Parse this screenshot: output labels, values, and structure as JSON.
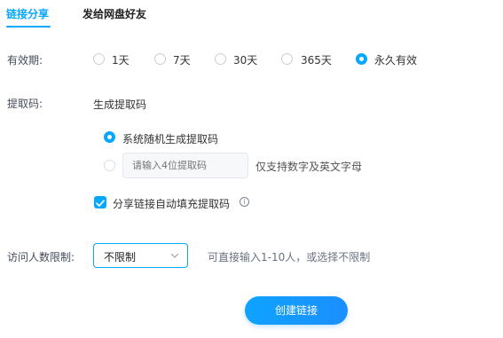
{
  "tabs": [
    {
      "label": "链接分享",
      "active": true
    },
    {
      "label": "发给网盘好友",
      "active": false
    }
  ],
  "validity": {
    "label": "有效期:",
    "options": [
      {
        "label": "1天",
        "selected": false
      },
      {
        "label": "7天",
        "selected": false
      },
      {
        "label": "30天",
        "selected": false
      },
      {
        "label": "365天",
        "selected": false
      },
      {
        "label": "永久有效",
        "selected": true
      }
    ]
  },
  "code": {
    "label": "提取码:",
    "mode_title": "生成提取码",
    "random_option": {
      "label": "系统随机生成提取码",
      "selected": true
    },
    "custom_option": {
      "selected": false,
      "placeholder": "请输入4位提取码",
      "hint": "仅支持数字及英文字母"
    },
    "autofill": {
      "label": "分享链接自动填充提取码",
      "checked": true,
      "info_icon": "info-icon"
    }
  },
  "visitors": {
    "label": "访问人数限制:",
    "selected": "不限制",
    "hint": "可直接输入1-10人，或选择不限制"
  },
  "create_button": "创建链接",
  "colors": {
    "accent": "#06a7ff"
  }
}
